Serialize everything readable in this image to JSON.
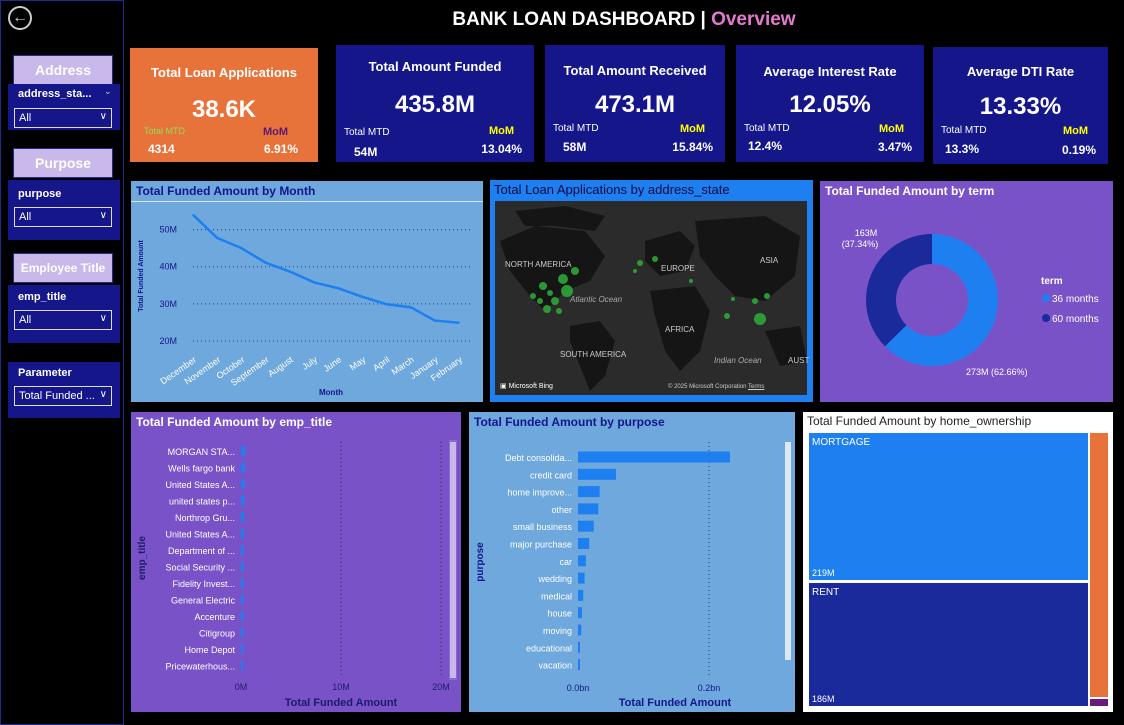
{
  "title": {
    "main": "BANK LOAN  DASHBOARD | ",
    "accent": "Overview"
  },
  "sidebar": {
    "address": {
      "header": "Address",
      "label": "address_sta...",
      "value": "All"
    },
    "purpose": {
      "header": "Purpose",
      "label": "purpose",
      "value": "All"
    },
    "emp_title": {
      "header": "Employee Title",
      "label": "emp_title",
      "value": "All"
    },
    "parameter": {
      "label": "Parameter",
      "value": "Total Funded ..."
    }
  },
  "kpis": [
    {
      "title": "Total Loan Applications",
      "value": "38.6K",
      "mtd_label": "Total MTD",
      "mtd": "4314",
      "mom_label": "MoM",
      "mom": "6.91%"
    },
    {
      "title": "Total Amount Funded",
      "value": "435.8M",
      "mtd_label": "Total MTD",
      "mtd": "54M",
      "mom_label": "MoM",
      "mom": "13.04%"
    },
    {
      "title": "Total Amount Received",
      "value": "473.1M",
      "mtd_label": "Total MTD",
      "mtd": "58M",
      "mom_label": "MoM",
      "mom": "15.84%"
    },
    {
      "title": "Average Interest Rate",
      "value": "12.05%",
      "mtd_label": "Total MTD",
      "mtd": "12.4%",
      "mom_label": "MoM",
      "mom": "3.47%"
    },
    {
      "title": "Average DTI Rate",
      "value": "13.33%",
      "mtd_label": "Total MTD",
      "mtd": "13.3%",
      "mom_label": "MoM",
      "mom": "0.19%"
    }
  ],
  "colors": {
    "navy": "#14168a",
    "orange": "#e8733a",
    "purple": "#7a52c7",
    "lightblue": "#6fa8dc",
    "blue": "#1e7ff0",
    "dark_blue": "#1b2a9a"
  },
  "map": {
    "title": "Total Loan Applications by address_state",
    "labels": [
      "NORTH AMERICA",
      "EUROPE",
      "ASIA",
      "Atlantic Ocean",
      "AFRICA",
      "SOUTH AMERICA",
      "Indian Ocean",
      "AUST"
    ],
    "attribution": "Microsoft Bing",
    "copyright": "© 2025 Microsoft Corporation",
    "terms": "Terms"
  },
  "home_ownership": {
    "title": "Total Funded Amount by home_ownership",
    "items": [
      {
        "name": "MORTGAGE",
        "value": "219M"
      },
      {
        "name": "RENT",
        "value": "186M"
      }
    ]
  },
  "chart_data": [
    {
      "type": "line",
      "title": "Total Funded Amount by Month",
      "xlabel": "Month",
      "ylabel": "Total Funded Amount",
      "categories": [
        "December",
        "November",
        "October",
        "September",
        "August",
        "July",
        "June",
        "May",
        "April",
        "March",
        "January",
        "February"
      ],
      "values": [
        53.98,
        47.75,
        45.0,
        41.1,
        38.7,
        35.8,
        34.2,
        31.9,
        29.9,
        29.1,
        25.5,
        24.9
      ],
      "yticks": [
        "20M",
        "30M",
        "40M",
        "50M"
      ],
      "ylim": [
        20,
        55
      ]
    },
    {
      "type": "pie",
      "title": "Total Funded Amount by term",
      "legend_title": "term",
      "labels": [
        "36 months",
        "60 months"
      ],
      "values": [
        273,
        163
      ],
      "data_labels": [
        "273M (62.66%)",
        "163M\n(37.34%)"
      ],
      "colors": [
        "#1e7ff0",
        "#1b2a9a"
      ]
    },
    {
      "type": "bar",
      "orientation": "horizontal",
      "title": "Total Funded Amount by emp_title",
      "ylabel": "emp_title",
      "xlabel": "Total Funded Amount",
      "categories": [
        "MORGAN STA...",
        "Wells fargo bank",
        "United States A...",
        "united states p...",
        "Northrop Gru...",
        "United States A...",
        "Department of ...",
        "Social Security ...",
        "Fidelity Invest...",
        "General Electric",
        "Accenture",
        "Citigroup",
        "Home Depot",
        "Pricewaterhous..."
      ],
      "values": [
        0.4,
        0.37,
        0.35,
        0.33,
        0.31,
        0.3,
        0.28,
        0.27,
        0.26,
        0.25,
        0.24,
        0.23,
        0.22,
        0.21
      ],
      "xticks": [
        "0M",
        "10M",
        "20M"
      ],
      "xlim": [
        0,
        20
      ]
    },
    {
      "type": "bar",
      "orientation": "horizontal",
      "title": "Total Funded Amount by purpose",
      "ylabel": "purpose",
      "xlabel": "Total Funded Amount",
      "categories": [
        "Debt consolida...",
        "credit card",
        "home improve...",
        "other",
        "small business",
        "major purchase",
        "car",
        "wedding",
        "medical",
        "house",
        "moving",
        "educational",
        "vacation"
      ],
      "values": [
        0.232,
        0.058,
        0.033,
        0.031,
        0.024,
        0.017,
        0.012,
        0.01,
        0.008,
        0.006,
        0.005,
        0.003,
        0.002
      ],
      "xticks": [
        "0.0bn",
        "0.2bn"
      ],
      "xlim": [
        0,
        0.2
      ]
    }
  ]
}
